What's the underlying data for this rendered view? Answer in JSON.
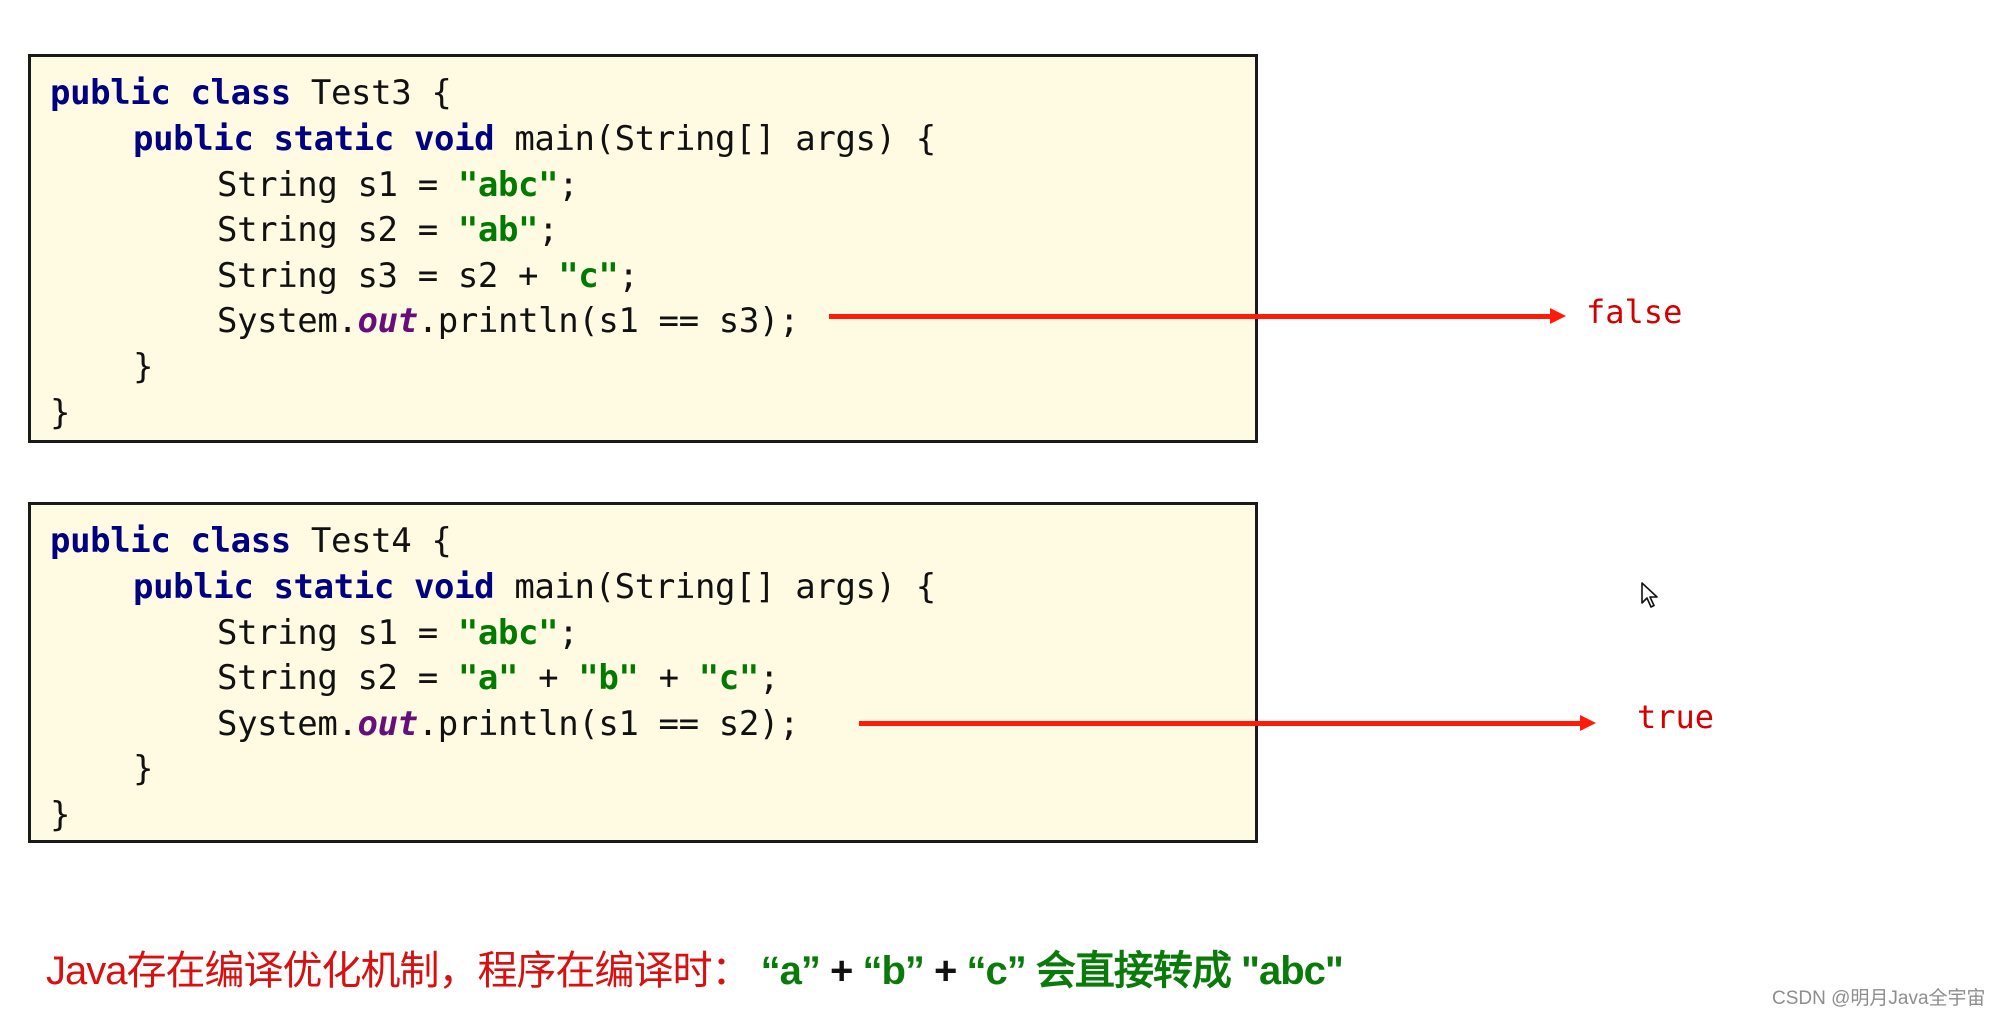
{
  "slide": {
    "test3": {
      "line1": {
        "kw": "public class",
        "rest": " Test3 {"
      },
      "line2": {
        "kw": "public static void",
        "rest": " main(String[] args) {"
      },
      "line3": {
        "pre": "String s1 = ",
        "str": "\"abc\"",
        "post": ";"
      },
      "line4": {
        "pre": "String s2 = ",
        "str": "\"ab\"",
        "post": ";"
      },
      "line5": {
        "pre": "String s3 = s2 + ",
        "str": "\"c\"",
        "post": ";"
      },
      "line6": {
        "pre": "System.",
        "fld": "out",
        "post": ".println(s1 == s3);"
      },
      "line7": "}",
      "line8": "}",
      "result": "false"
    },
    "test4": {
      "line1": {
        "kw": "public class",
        "rest": " Test4 {"
      },
      "line2": {
        "kw": "public static void",
        "rest": " main(String[] args) {"
      },
      "line3": {
        "pre": "String s1 = ",
        "str": "\"abc\"",
        "post": ";"
      },
      "line4": {
        "pre": "String s2 = ",
        "str1": "\"a\"",
        "op1": " + ",
        "str2": "\"b\"",
        "op2": " + ",
        "str3": "\"c\"",
        "post": ";"
      },
      "line5": {
        "pre": "System.",
        "fld": "out",
        "post": ".println(s1 == s2);"
      },
      "line6": "}",
      "line7": "}",
      "result": "true"
    },
    "note": {
      "prefix": "Java存在编译优化机制，程序在编译时：",
      "a": "“a”",
      "plus1": "+",
      "b": "“b”",
      "plus2": "+",
      "c": "“c”",
      "middle": "会直接转成",
      "abc": "\"abc\""
    },
    "watermark": "CSDN @明月Java全宇宙"
  },
  "colors": {
    "keyword": "#000080",
    "string": "#007a00",
    "field": "#660e7a",
    "arrow": "#ff1a0a",
    "result": "#d40000",
    "box_background": "#fffbe3"
  }
}
